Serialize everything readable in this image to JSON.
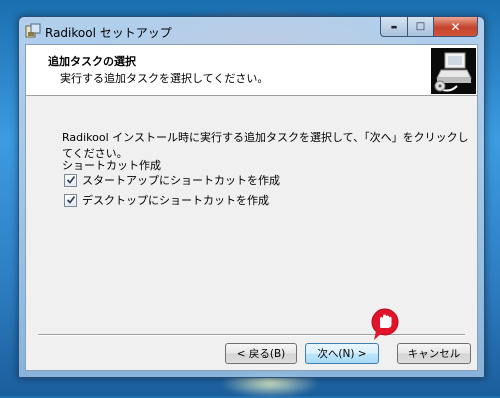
{
  "window": {
    "title": "Radikool セットアップ",
    "minimize_glyph": "▬",
    "maximize_glyph": "□",
    "close_glyph": "✕"
  },
  "header": {
    "title": "追加タスクの選択",
    "subtitle": "実行する追加タスクを選択してください。",
    "logo_icon": "installer-computer-icon"
  },
  "body": {
    "instruction": "Radikool インストール時に実行する追加タスクを選択して、「次へ」をクリックしてください。",
    "group_label": "ショートカット作成",
    "tasks": [
      {
        "label": "スタートアップにショートカットを作成",
        "checked": true
      },
      {
        "label": "デスクトップにショートカットを作成",
        "checked": true
      }
    ]
  },
  "buttons": {
    "back": "< 戻る(B)",
    "next": "次へ(N) >",
    "cancel": "キャンセル"
  },
  "colors": {
    "accent_next_border": "#3c7fb1",
    "close_button": "#c4432c",
    "cursor_badge": "#e0142b"
  }
}
